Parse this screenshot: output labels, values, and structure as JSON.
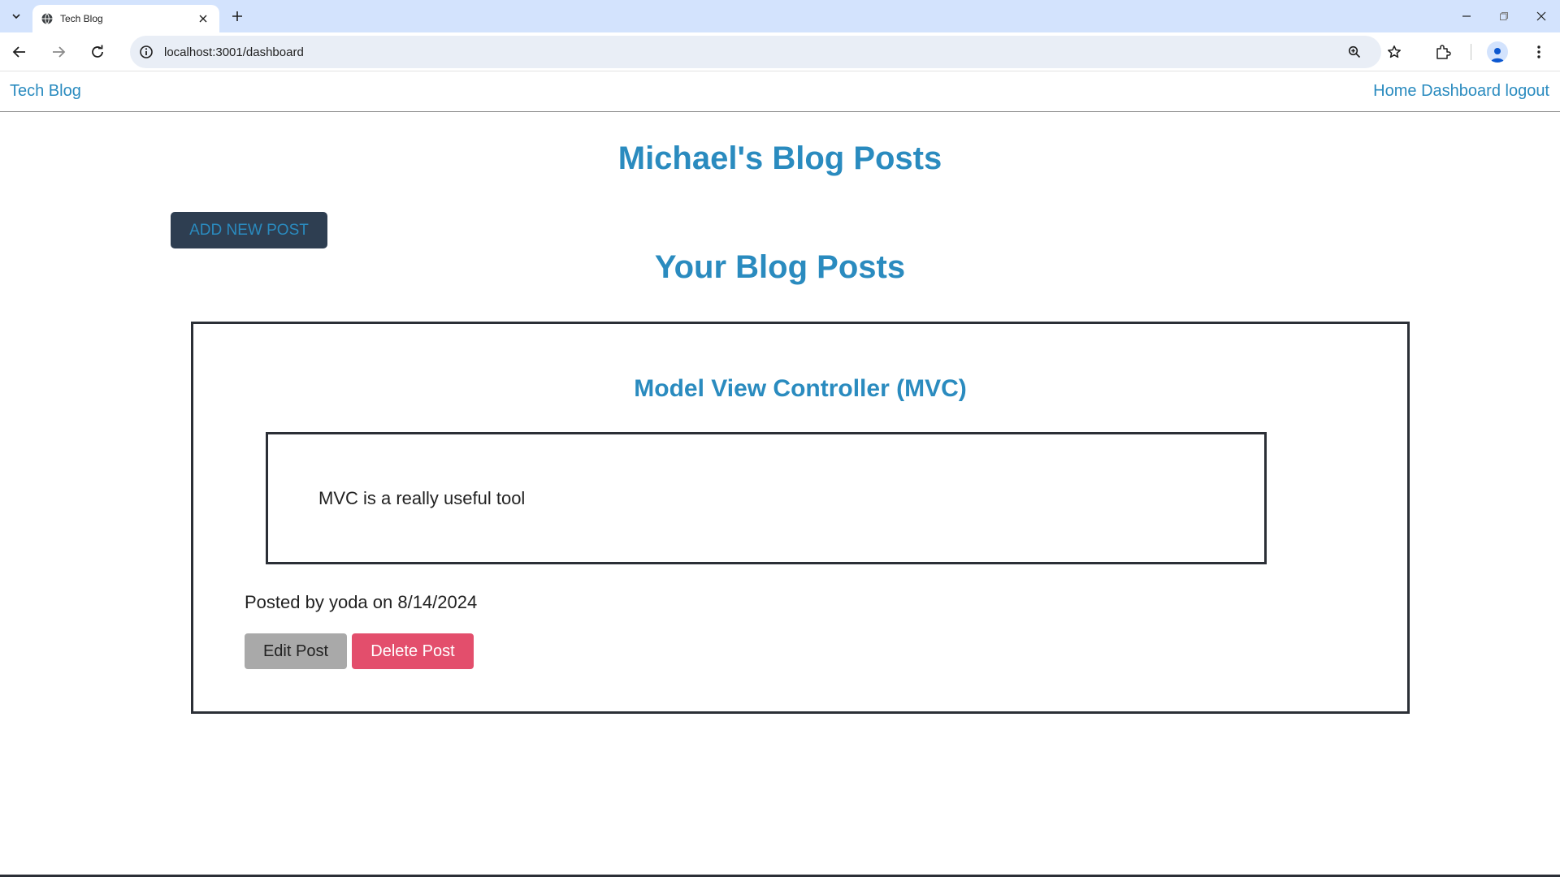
{
  "browser": {
    "tab_title": "Tech Blog",
    "url": "localhost:3001/dashboard",
    "icons": [
      "tab-list-icon",
      "globe-icon",
      "close-icon",
      "plus-icon",
      "minimize-icon",
      "restore-icon",
      "close-window-icon",
      "back-arrow-icon",
      "forward-arrow-icon",
      "reload-icon",
      "site-info-icon",
      "zoom-icon",
      "star-icon",
      "extensions-icon",
      "profile-icon",
      "menu-dots-icon"
    ]
  },
  "site_nav": {
    "brand": "Tech Blog",
    "links": [
      {
        "label": "Home"
      },
      {
        "label": "Dashboard"
      },
      {
        "label": "logout"
      }
    ]
  },
  "main": {
    "page_title": "Michael's Blog Posts",
    "add_button_label": "ADD NEW POST",
    "section_title": "Your Blog Posts",
    "posts": [
      {
        "title": "Model View Controller (MVC)",
        "content": "MVC is a really useful tool",
        "meta": "Posted by yoda on 8/14/2024",
        "edit_label": "Edit Post",
        "delete_label": "Delete Post"
      }
    ]
  },
  "colors": {
    "link_blue": "#2a8bbf",
    "add_button_bg": "#2e3e51",
    "delete_button_bg": "#e34e6c",
    "edit_button_bg": "#a9a9a9",
    "border": "#2b2f36"
  }
}
